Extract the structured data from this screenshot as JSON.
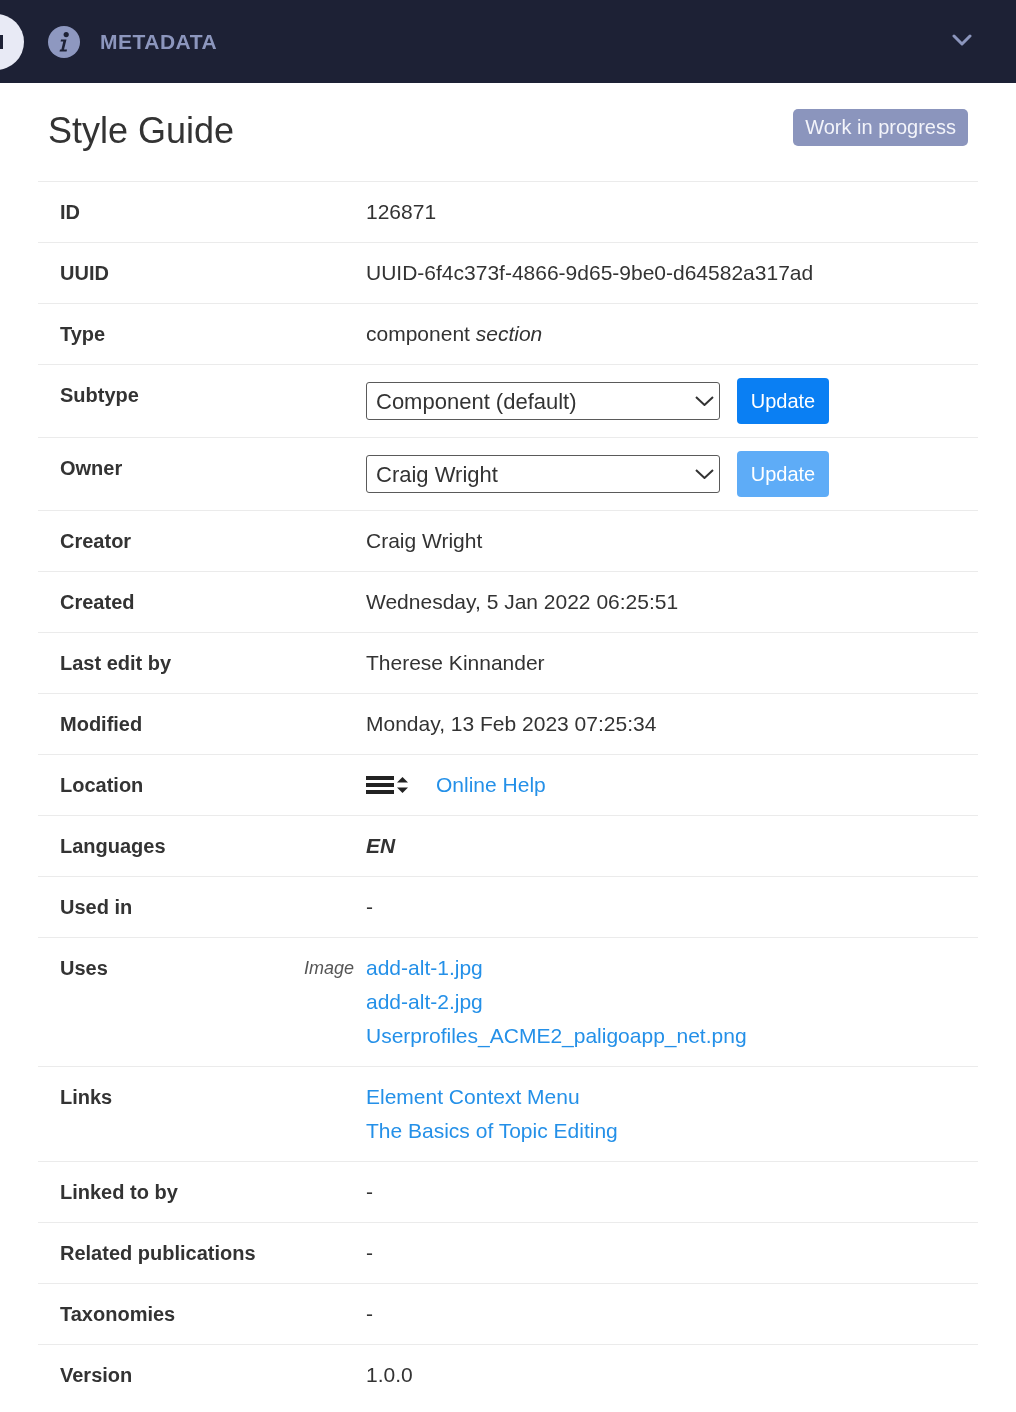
{
  "header": {
    "title": "METADATA"
  },
  "title": "Style Guide",
  "status_badge": "Work in progress",
  "rows": [
    {
      "kind": "text",
      "label": "ID",
      "value": "126871"
    },
    {
      "kind": "text",
      "label": "UUID",
      "value": "UUID-6f4c373f-4866-9d65-9be0-d64582a317ad"
    },
    {
      "kind": "text",
      "label": "Type",
      "value": "component *section*"
    },
    {
      "kind": "select",
      "label": "Subtype",
      "value": "Component (default)",
      "button": {
        "label": "Update",
        "disabled": false
      }
    },
    {
      "kind": "select",
      "label": "Owner",
      "value": "Craig Wright",
      "button": {
        "label": "Update",
        "disabled": true
      }
    },
    {
      "kind": "text",
      "label": "Creator",
      "value": "Craig Wright"
    },
    {
      "kind": "text",
      "label": "Created",
      "value": "Wednesday, 5 Jan 2022 06:25:51"
    },
    {
      "kind": "text",
      "label": "Last edit by",
      "value": "Therese Kinnander"
    },
    {
      "kind": "text",
      "label": "Modified",
      "value": "Monday, 13 Feb 2023 07:25:34"
    },
    {
      "kind": "location",
      "label": "Location",
      "link": "Online Help"
    },
    {
      "kind": "emphasis",
      "label": "Languages",
      "value": "EN"
    },
    {
      "kind": "text",
      "label": "Used in",
      "value": "-"
    },
    {
      "kind": "links",
      "label": "Uses",
      "side_label": "Image",
      "links": [
        "add-alt-1.jpg",
        "add-alt-2.jpg",
        "Userprofiles_ACME2_paligoapp_net.png"
      ]
    },
    {
      "kind": "links",
      "label": "Links",
      "links": [
        "Element Context Menu",
        "The Basics of Topic Editing"
      ]
    },
    {
      "kind": "text",
      "label": "Linked to by",
      "value": "-"
    },
    {
      "kind": "text",
      "label": "Related publications",
      "value": "-"
    },
    {
      "kind": "text",
      "label": "Taxonomies",
      "value": "-"
    },
    {
      "kind": "text",
      "label": "Version",
      "value": "1.0.0"
    }
  ]
}
